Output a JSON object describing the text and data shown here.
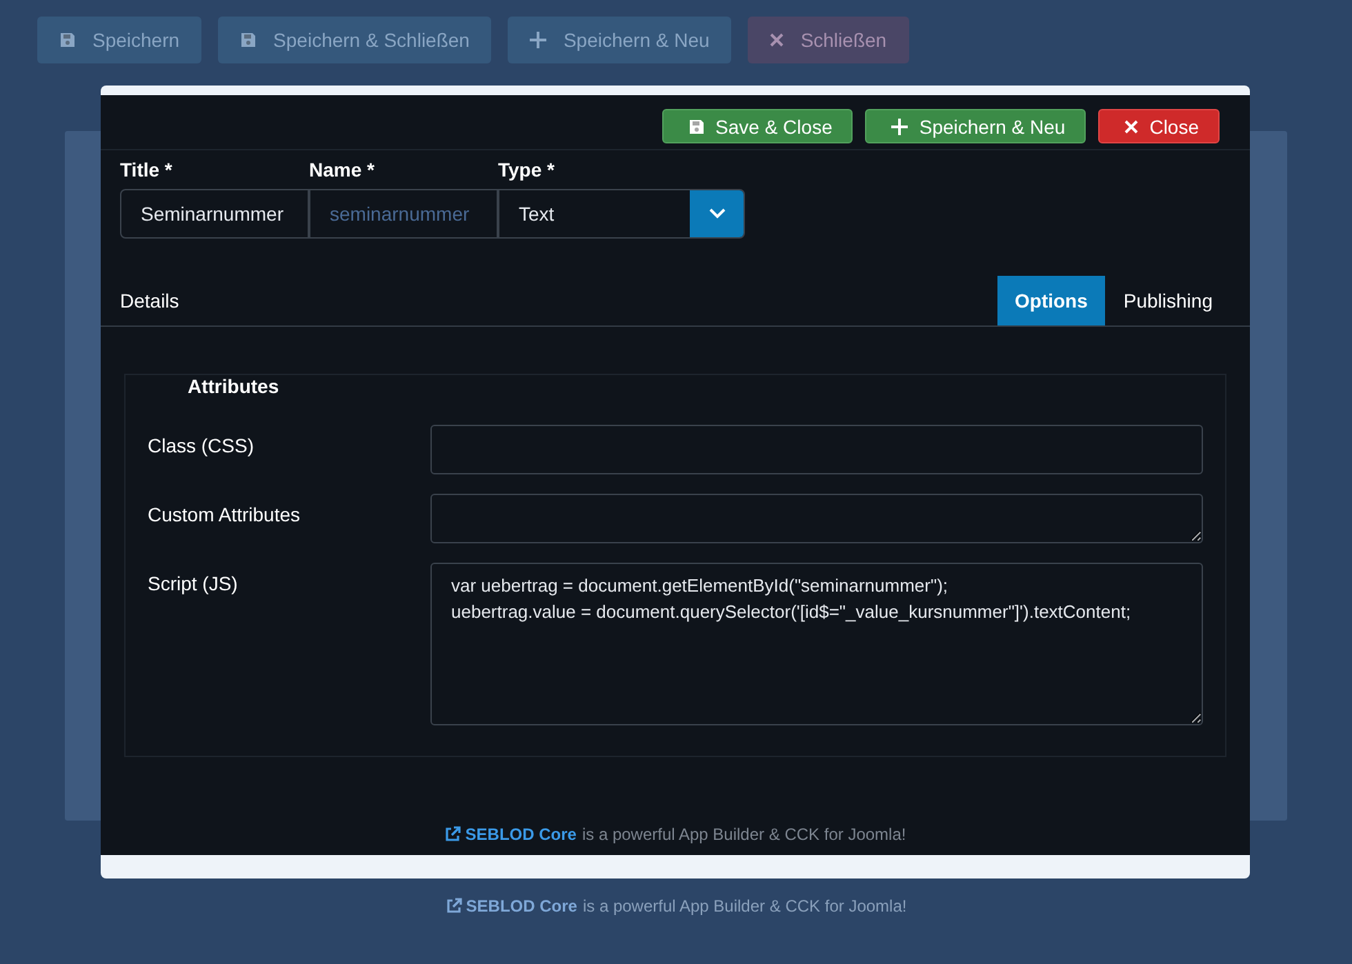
{
  "background_page": {
    "toolbar": [
      {
        "label": "Speichern",
        "kind": "save"
      },
      {
        "label": "Speichern & Schließen",
        "kind": "save"
      },
      {
        "label": "Speichern & Neu",
        "kind": "new"
      },
      {
        "label": "Schließen",
        "kind": "close"
      }
    ],
    "footer": {
      "link": "SEBLOD Core",
      "text": "is a powerful App Builder & CCK for Joomla!"
    }
  },
  "modal": {
    "toolbar": [
      {
        "label": "Save & Close",
        "kind": "save"
      },
      {
        "label": "Speichern & Neu",
        "kind": "new"
      },
      {
        "label": "Close",
        "kind": "close"
      }
    ],
    "fields": [
      {
        "label": "Title *",
        "value": "Seminarnummer",
        "disabled": false
      },
      {
        "label": "Name *",
        "value": "seminarnummer",
        "disabled": true
      }
    ],
    "type_field": {
      "label": "Type *",
      "value": "Text"
    },
    "tabs": [
      {
        "label": "Details",
        "selected": false
      },
      {
        "label": "Options",
        "selected": true
      },
      {
        "label": "Publishing",
        "selected": false
      }
    ],
    "fieldset": {
      "legend": "Attributes",
      "rows": [
        {
          "label": "Class (CSS)",
          "kind": "input"
        },
        {
          "label": "Custom Attributes",
          "kind": "textarea"
        },
        {
          "label": "Script (JS)",
          "kind": "code",
          "lines": [
            "var uebertrag = document.getElementById(\"seminarnummer\");",
            "uebertrag.value = document.querySelector('[id$=\"_value_kursnummer\"]').textContent;"
          ]
        }
      ]
    },
    "footer": {
      "link": "SEBLOD Core",
      "text": "is a powerful App Builder & CCK for Joomla!"
    }
  }
}
